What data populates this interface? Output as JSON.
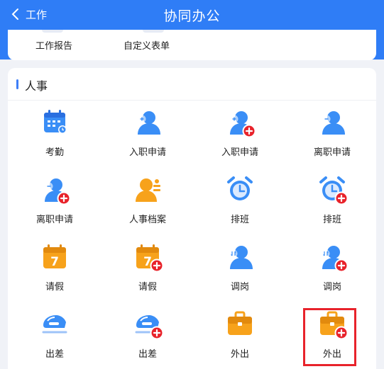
{
  "header": {
    "back_label": "工作",
    "title": "协同办公",
    "background": "#2f7df6"
  },
  "top_card": {
    "items": [
      {
        "label": "工作报告"
      },
      {
        "label": "自定义表单"
      }
    ]
  },
  "section": {
    "title": "人事",
    "accent": "#3d7ef7",
    "items": [
      {
        "label": "考勤",
        "icon": "calendar-clock-icon"
      },
      {
        "label": "入职申请",
        "icon": "user-add-icon"
      },
      {
        "label": "入职申请",
        "icon": "user-add-plus-icon"
      },
      {
        "label": "离职申请",
        "icon": "user-remove-icon"
      },
      {
        "label": "离职申请",
        "icon": "user-remove-plus-icon"
      },
      {
        "label": "人事档案",
        "icon": "user-profile-icon"
      },
      {
        "label": "排班",
        "icon": "alarm-clock-icon"
      },
      {
        "label": "排班",
        "icon": "alarm-clock-plus-icon"
      },
      {
        "label": "请假",
        "icon": "calendar-7-icon"
      },
      {
        "label": "请假",
        "icon": "calendar-7-plus-icon"
      },
      {
        "label": "调岗",
        "icon": "user-transfer-icon"
      },
      {
        "label": "调岗",
        "icon": "user-transfer-plus-icon"
      },
      {
        "label": "出差",
        "icon": "train-icon"
      },
      {
        "label": "出差",
        "icon": "train-plus-icon"
      },
      {
        "label": "外出",
        "icon": "briefcase-icon"
      },
      {
        "label": "外出",
        "icon": "briefcase-plus-icon"
      }
    ]
  },
  "colors": {
    "blue": "#3a8ef6",
    "orange": "#f7a21b",
    "red_badge": "#e8232b",
    "highlight": "#e8232b"
  }
}
